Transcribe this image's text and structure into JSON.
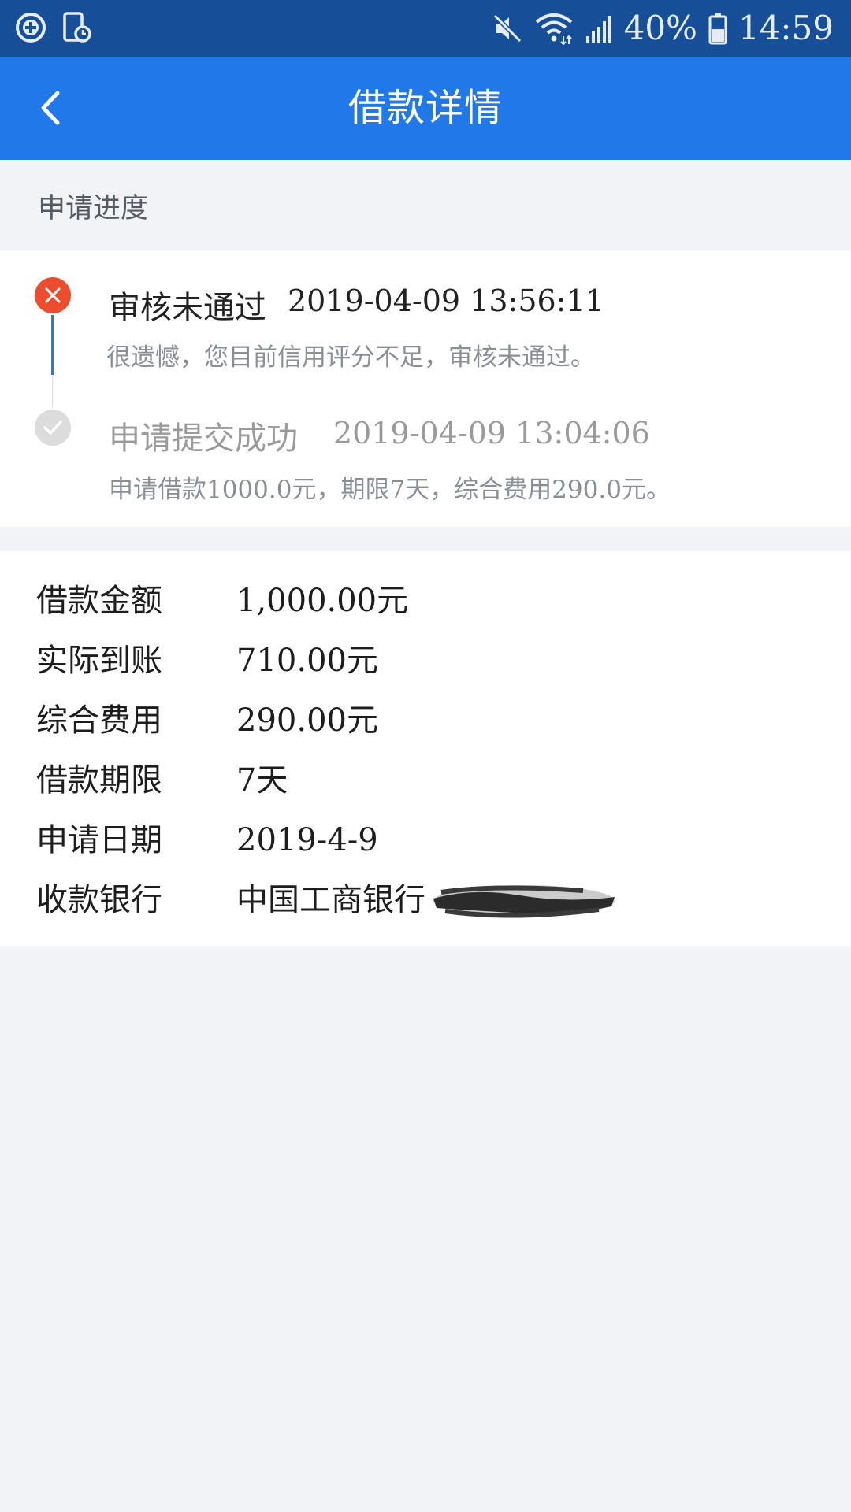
{
  "status_bar": {
    "battery_percent": "40%",
    "time": "14:59",
    "icons": [
      "add-circle-icon",
      "screen-recorder-icon",
      "mute-icon",
      "wifi-icon",
      "signal-icon",
      "battery-icon"
    ]
  },
  "app_bar": {
    "title": "借款详情",
    "back_icon": "chevron-left-icon"
  },
  "progress": {
    "header": "申请进度",
    "steps": [
      {
        "title": "审核未通过",
        "time": "2019-04-09 13:56:11",
        "desc": "很遗憾，您目前信用评分不足，审核未通过。",
        "status": "rejected",
        "icon": "close-circle-icon",
        "color": "#ec4d2f"
      },
      {
        "title": "申请提交成功",
        "time": "2019-04-09 13:04:06",
        "desc": "申请借款1000.0元，期限7天，综合费用290.0元。",
        "status": "done",
        "icon": "check-circle-icon",
        "color": "#dcdcdc"
      }
    ]
  },
  "details": [
    {
      "label": "借款金额",
      "value": "1,000.00元"
    },
    {
      "label": "实际到账",
      "value": "710.00元"
    },
    {
      "label": "综合费用",
      "value": "290.00元"
    },
    {
      "label": "借款期限",
      "value": "7天"
    },
    {
      "label": "申请日期",
      "value": "2019-4-9"
    },
    {
      "label": "收款银行",
      "value": "中国工商银行"
    }
  ],
  "colors": {
    "status_bar": "#164f98",
    "app_bar": "#2178e8",
    "background": "#f2f3f7",
    "timeline_active": "#2a7ad6"
  }
}
